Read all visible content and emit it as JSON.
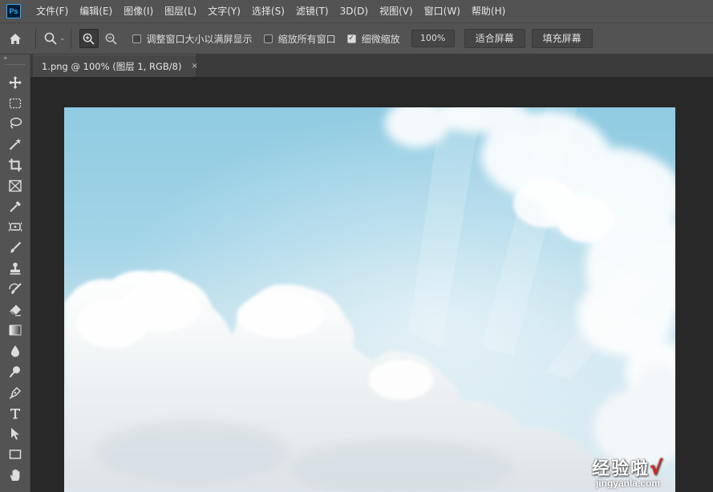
{
  "app": {
    "logo_text": "Ps"
  },
  "menu": [
    "文件(F)",
    "编辑(E)",
    "图像(I)",
    "图层(L)",
    "文字(Y)",
    "选择(S)",
    "滤镜(T)",
    "3D(D)",
    "视图(V)",
    "窗口(W)",
    "帮助(H)"
  ],
  "options": {
    "resize_windows_label": "调整窗口大小以满屏显示",
    "resize_windows_checked": false,
    "zoom_all_label": "缩放所有窗口",
    "zoom_all_checked": false,
    "scrubby_zoom_label": "细微缩放",
    "scrubby_zoom_checked": true,
    "zoom_value": "100%",
    "fit_screen_label": "适合屏幕",
    "fill_screen_label": "填充屏幕"
  },
  "document": {
    "tab_title": "1.png @ 100% (图层 1, RGB/8)",
    "close_glyph": "×"
  },
  "toolbar": {
    "tools": [
      "move-tool",
      "marquee-tool",
      "lasso-tool",
      "magic-wand-tool",
      "crop-tool",
      "frame-tool",
      "eyedropper-tool",
      "healing-brush-tool",
      "brush-tool",
      "clone-stamp-tool",
      "history-brush-tool",
      "eraser-tool",
      "gradient-tool",
      "blur-tool",
      "dodge-tool",
      "pen-tool",
      "type-tool",
      "path-selection-tool",
      "rectangle-tool",
      "hand-tool"
    ]
  },
  "watermark": {
    "text": "经验啦",
    "check": "√",
    "url": "jingyanla.com"
  },
  "colors": {
    "chrome": "#535353",
    "canvas_bg": "#282828",
    "sky": "#8fcbe2"
  }
}
